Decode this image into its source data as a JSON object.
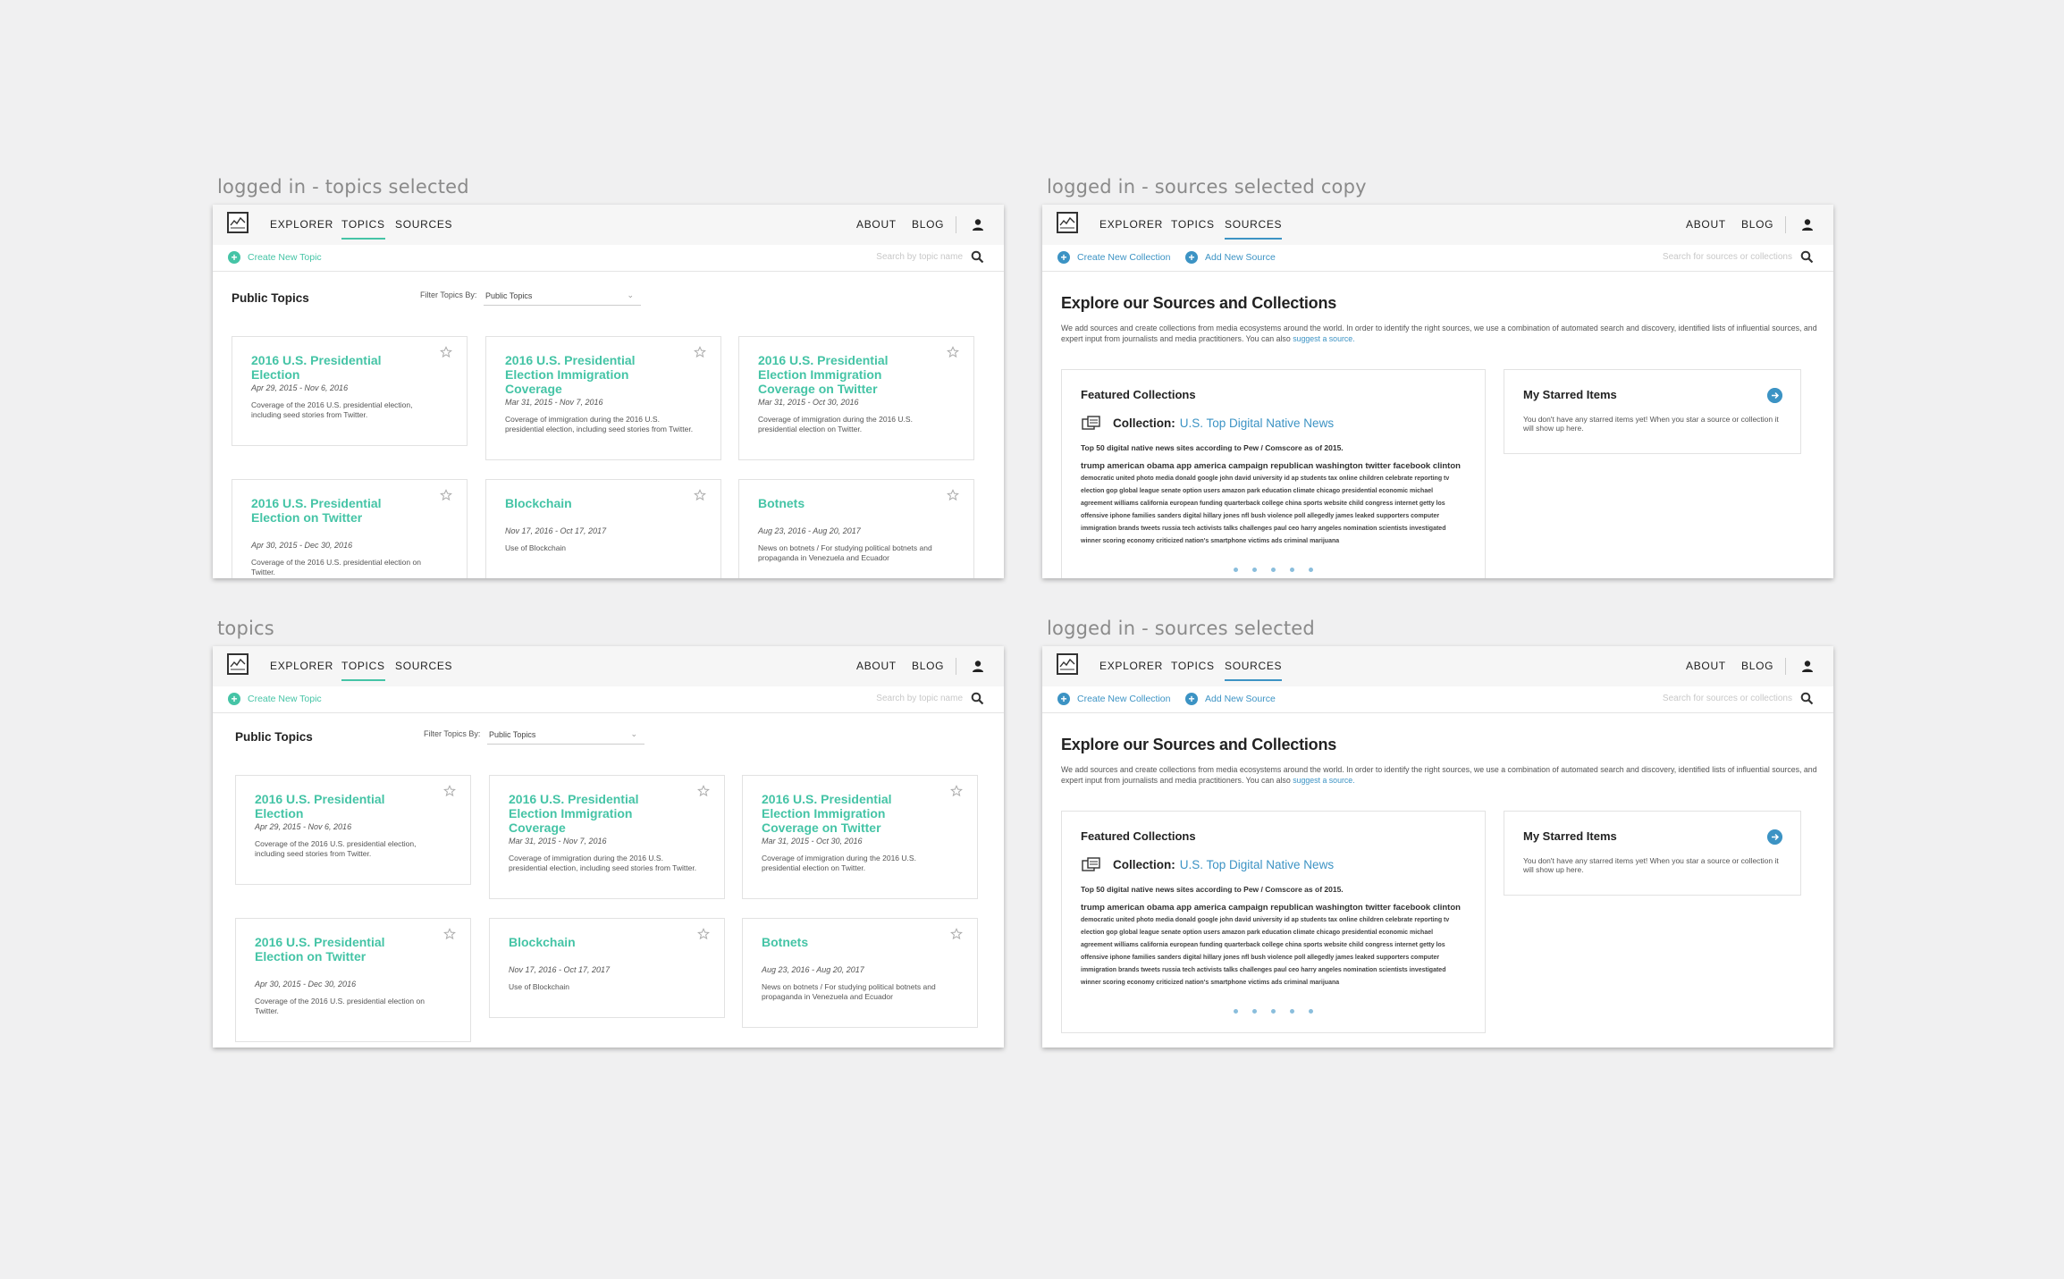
{
  "artboards": {
    "a1": "logged in - topics selected",
    "a2": "logged in - sources selected copy",
    "a3": "topics",
    "a4": "logged in - sources selected"
  },
  "nav": {
    "explorer": "EXPLORER",
    "topics": "TOPICS",
    "sources": "SOURCES",
    "about": "ABOUT",
    "blog": "BLOG",
    "icons": {
      "logo": "media-cloud-logo",
      "user": "user-icon"
    }
  },
  "topics_page": {
    "create_label": "Create New Topic",
    "search_placeholder": "Search by topic name",
    "title": "Public Topics",
    "filter_label": "Filter Topics By:",
    "filter_value": "Public Topics",
    "cards": [
      {
        "title": "2016 U.S. Presidential Election",
        "date": "Apr 29, 2015 - Nov 6, 2016",
        "desc": "Coverage of the 2016 U.S. presidential election, including seed stories from Twitter."
      },
      {
        "title": "2016 U.S. Presidential Election Immigration Coverage",
        "date": "Mar 31, 2015 - Nov 7, 2016",
        "desc": "Coverage of immigration during the 2016 U.S. presidential election, including seed stories from Twitter."
      },
      {
        "title": "2016 U.S. Presidential Election Immigration Coverage on Twitter",
        "date": "Mar 31, 2015 - Oct 30, 2016",
        "desc": "Coverage of immigration during the 2016 U.S. presidential election on Twitter."
      },
      {
        "title": "2016 U.S. Presidential Election on Twitter",
        "date": "Apr 30, 2015 - Dec 30, 2016",
        "desc": "Coverage of the 2016 U.S. presidential election on Twitter."
      },
      {
        "title": "Blockchain",
        "date": "Nov 17, 2016 - Oct 17, 2017",
        "desc": "Use of Blockchain"
      },
      {
        "title": "Botnets",
        "date": "Aug 23, 2016 - Aug 20, 2017",
        "desc": "News on botnets / For studying political botnets and propaganda in Venezuela and Ecuador"
      }
    ]
  },
  "sources_page": {
    "create_collection": "Create New Collection",
    "add_source": "Add New Source",
    "search_placeholder": "Search for sources or collections",
    "heading": "Explore our Sources and Collections",
    "intro": "We add sources and create collections from media ecosystems around the world. In order to identify the right sources, we use a combination of automated search and discovery, identified lists of influential sources, and expert input from journalists and media practitioners. You can also",
    "intro_link": "suggest a source.",
    "featured_title": "Featured Collections",
    "collection_label": "Collection:",
    "collection_name": "U.S. Top Digital Native News",
    "collection_sub": "Top 50 digital native news sites according to Pew / Comscore as of 2015.",
    "words_line1": "trump american obama app america campaign republican washington twitter facebook clinton",
    "words_rest": "democratic united photo media donald google john david university id ap students tax online children celebrate reporting tv election gop global league senate option users amazon park education climate chicago presidential economic michael agreement williams california european funding quarterback college china sports website child congress internet getty los offensive iphone families sanders digital hillary jones nfl bush violence poll allegedly james leaked supporters computer immigration brands tweets russia tech activists talks challenges paul ceo harry angeles nomination scientists investigated winner scoring economy criticized nation's smartphone victims ads criminal marijuana",
    "starred_title": "My Starred Items",
    "starred_desc": "You don't have any starred items yet! When you star a source or collection it will show up here."
  },
  "colors": {
    "topics_accent": "#45c4a6",
    "sources_accent": "#3c93c4"
  }
}
